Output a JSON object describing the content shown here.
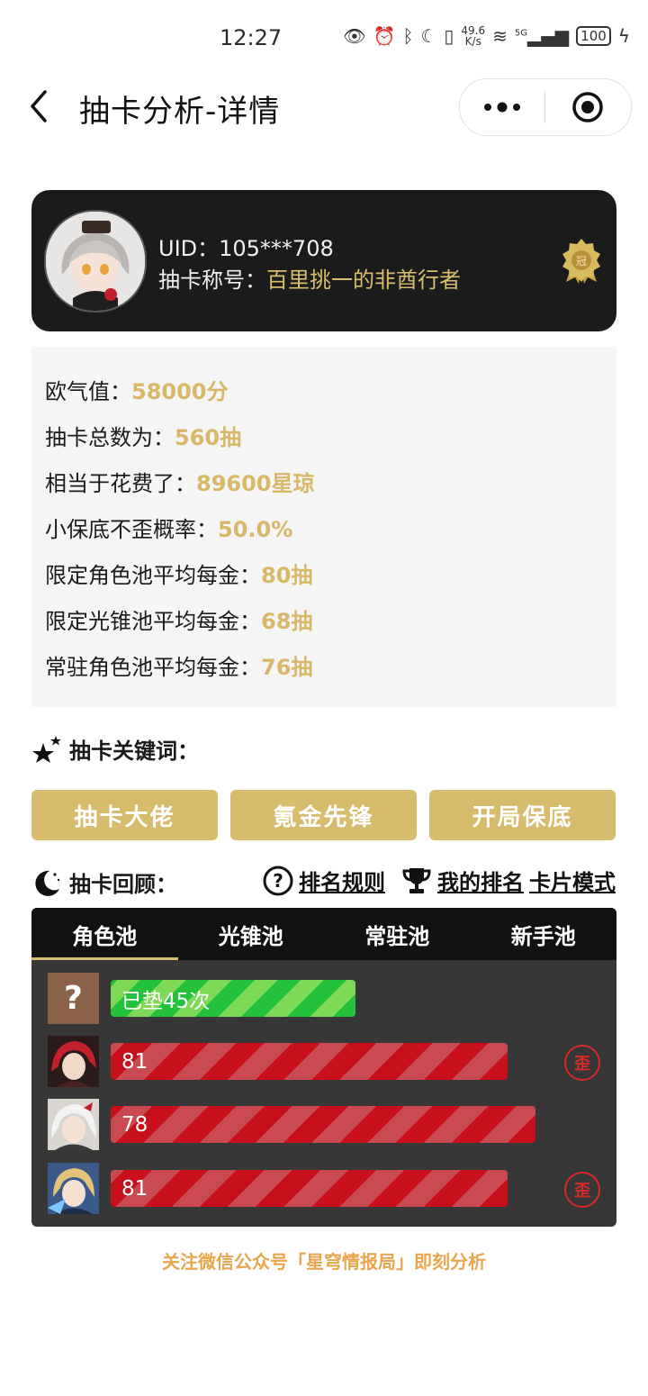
{
  "status_bar": {
    "time": "12:27",
    "net_speed_value": "49.6",
    "net_speed_unit": "K/s",
    "signal_type": "5G",
    "battery": "100"
  },
  "header": {
    "title": "抽卡分析-详情"
  },
  "profile": {
    "uid": "UID：105***708",
    "title_label": "抽卡称号：",
    "title_value": "百里挑一的非酋行者"
  },
  "stats": [
    {
      "label": "欧气值：",
      "value": "58000分"
    },
    {
      "label": "抽卡总数为：",
      "value": "560抽"
    },
    {
      "label": "相当于花费了：",
      "value": "89600星琼"
    },
    {
      "label": "小保底不歪概率：",
      "value": "50.0%"
    },
    {
      "label": "限定角色池平均每金：",
      "value": "80抽"
    },
    {
      "label": "限定光锥池平均每金：",
      "value": "68抽"
    },
    {
      "label": "常驻角色池平均每金：",
      "value": "76抽"
    }
  ],
  "keywords": {
    "heading": "抽卡关键词：",
    "tags": [
      "抽卡大佬",
      "氪金先锋",
      "开局保底"
    ]
  },
  "review": {
    "heading": "抽卡回顾：",
    "rules_link": "排名规则",
    "rank_link": "我的排名",
    "card_mode_link": "卡片模式",
    "tabs": [
      "角色池",
      "光锥池",
      "常驻池",
      "新手池"
    ],
    "active_tab": 0,
    "pending": {
      "icon": "?",
      "label": "已垫45次",
      "count": 45
    },
    "pulls": [
      {
        "count": "81",
        "off_banner": true,
        "off_label": "歪"
      },
      {
        "count": "78",
        "off_banner": false,
        "off_label": ""
      },
      {
        "count": "81",
        "off_banner": true,
        "off_label": "歪"
      }
    ]
  },
  "footer": {
    "note": "关注微信公众号「星穹情报局」即刻分析"
  },
  "colors": {
    "gold": "#d8bc6d",
    "dark_card": "#1c1b1b",
    "green_bar": "#23c13c",
    "red_bar": "#c8101b",
    "footer_orange": "#e8a64f"
  }
}
